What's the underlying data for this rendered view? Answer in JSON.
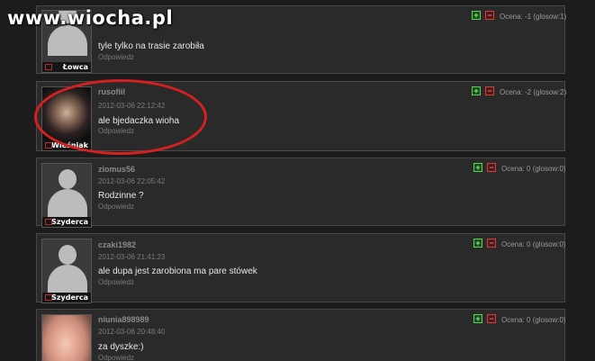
{
  "watermark": "www.wiocha.pl",
  "comments": [
    {
      "username": "",
      "date": "",
      "text": "tyle tylko na trasie zarobiła",
      "reply": "Odpowiedz",
      "rank": "Łowca",
      "avatar": "default-silhouette",
      "rating": "Ocena: -1 (glosow:1)"
    },
    {
      "username": "rusofiil",
      "date": "2012-03-06 22:12:42",
      "text": "ale bjedaczka wioha",
      "reply": "Odpowiedz",
      "rank": "Wieśniak",
      "avatar": "photo",
      "rating": "Ocena: -2 (glosow:2)"
    },
    {
      "username": "ziomus56",
      "date": "2012-03-06 22:05:42",
      "text": "Rodzinne ?",
      "reply": "Odpowiedz",
      "rank": "Szyderca",
      "avatar": "default-silhouette",
      "rating": "Ocena: 0 (glosow:0)"
    },
    {
      "username": "czaki1982",
      "date": "2012-03-06 21:41:23",
      "text": "ale dupa jest zarobiona ma pare stówek",
      "reply": "Odpowiedz",
      "rank": "Szyderca",
      "avatar": "default-silhouette",
      "rating": "Ocena: 0 (glosow:0)"
    },
    {
      "username": "niunia898989",
      "date": "2012-03-06 20:48:40",
      "text": "za dyszke:)",
      "reply": "Odpowiedz",
      "rank": "",
      "avatar": "photo",
      "rating": "Ocena: 0 (glosow:0)"
    }
  ],
  "vote_labels": {
    "up": "+",
    "down": "−"
  },
  "colors": {
    "vote_up": "#5ad15a",
    "vote_down": "#e03c3c",
    "highlight_circle": "#d42020"
  }
}
